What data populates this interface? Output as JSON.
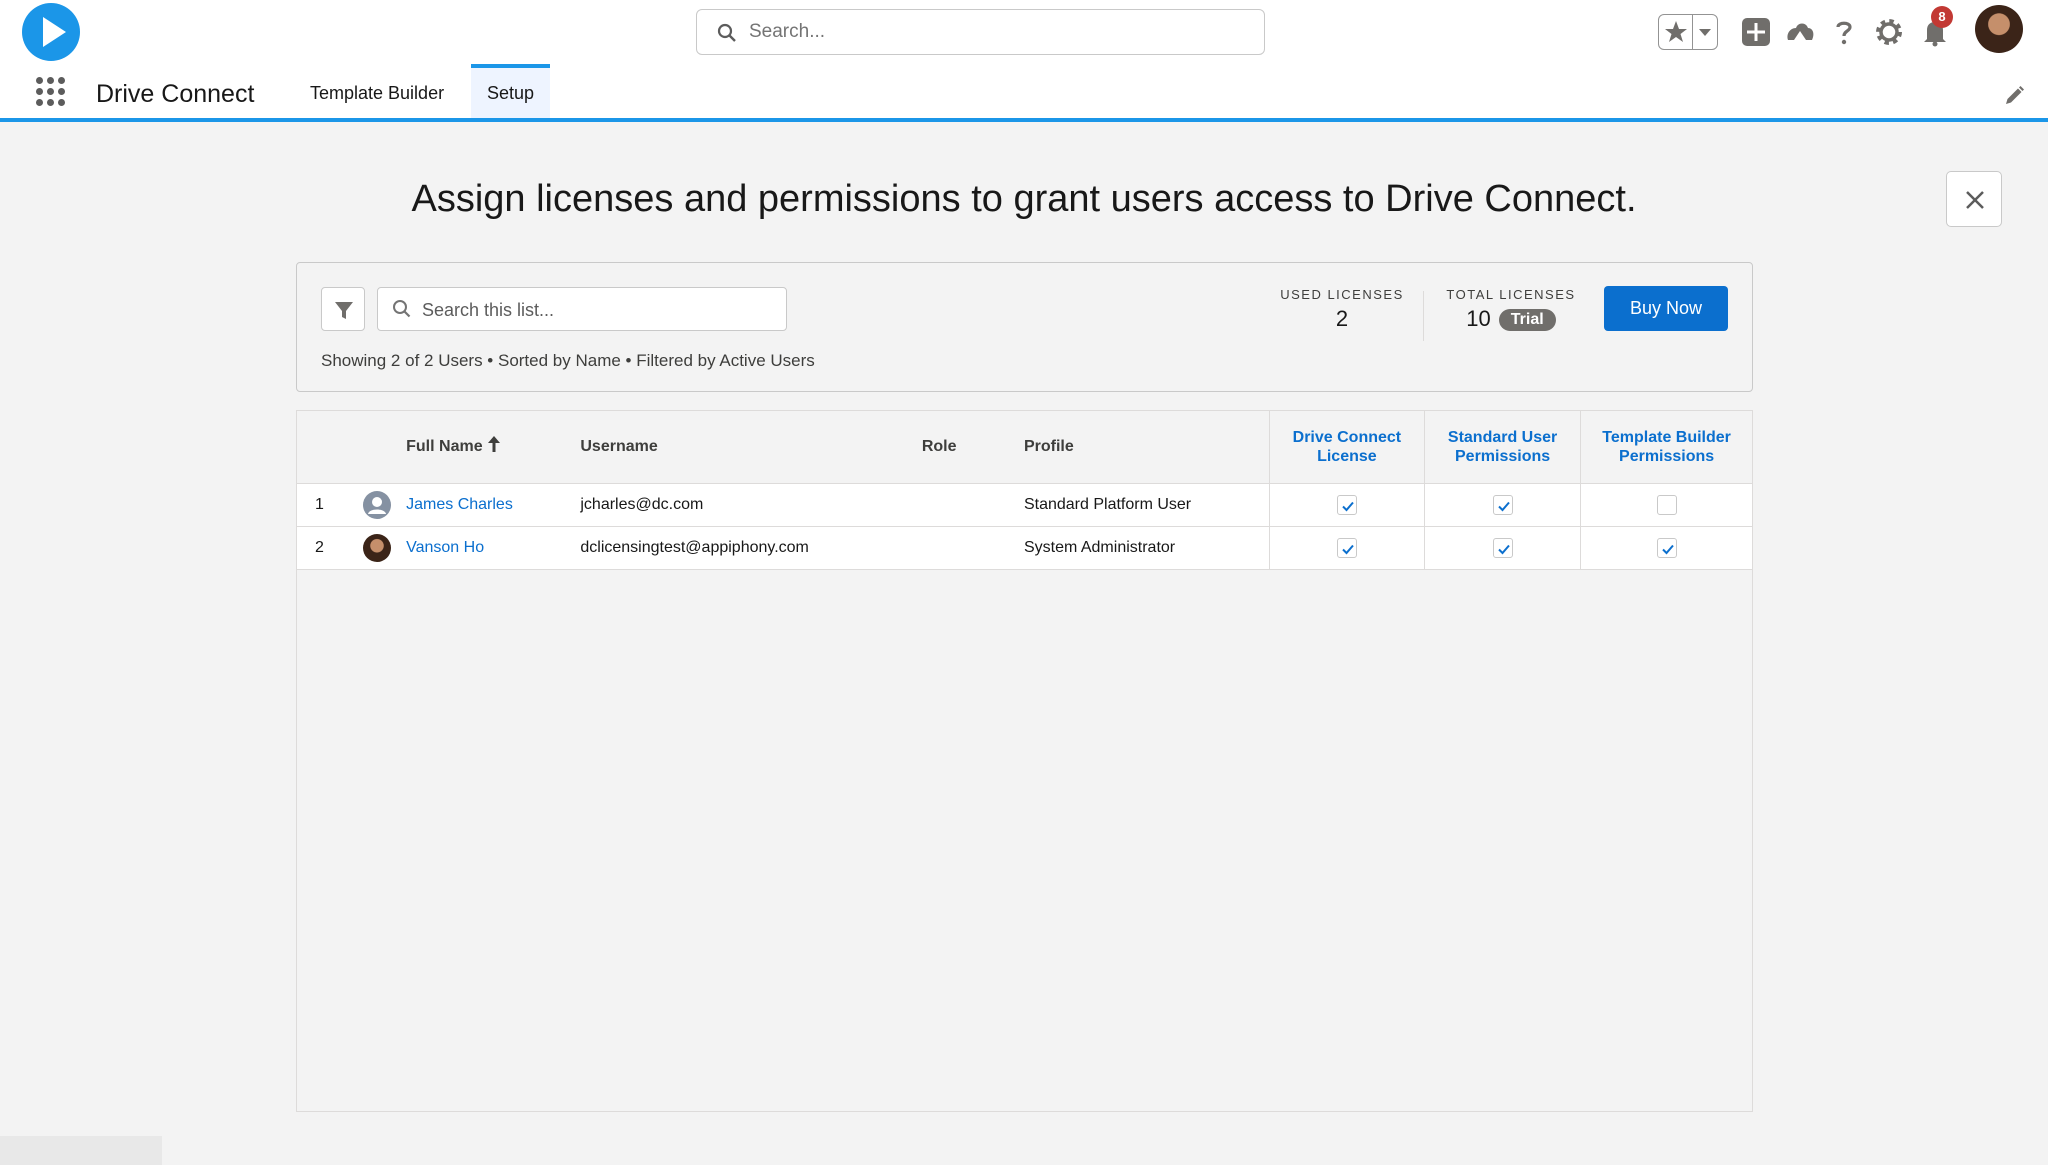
{
  "header": {
    "search_placeholder": "Search...",
    "notification_count": "8",
    "icons": [
      "play-logo-icon",
      "search-icon",
      "star-icon",
      "chevron-down-icon",
      "add-icon",
      "trailhead-icon",
      "help-icon",
      "gear-icon",
      "bell-icon"
    ]
  },
  "nav": {
    "app_name": "Drive Connect",
    "tabs": [
      {
        "label": "Template Builder",
        "active": false
      },
      {
        "label": "Setup",
        "active": true
      }
    ]
  },
  "main": {
    "title": "Assign licenses and permissions to grant users access to Drive Connect."
  },
  "toolbar": {
    "search_placeholder": "Search this list...",
    "summary": "Showing 2 of 2 Users • Sorted by Name • Filtered by Active Users",
    "used_licenses_label": "USED LICENSES",
    "used_licenses_value": "2",
    "total_licenses_label": "TOTAL LICENSES",
    "total_licenses_value": "10",
    "trial_label": "Trial",
    "buy_label": "Buy Now"
  },
  "table": {
    "headers": {
      "full_name": "Full Name",
      "username": "Username",
      "role": "Role",
      "profile": "Profile",
      "drive_connect_license": "Drive Connect License",
      "standard_user_permissions": "Standard User Permissions",
      "template_builder_permissions": "Template Builder Permissions"
    },
    "rows": [
      {
        "num": "1",
        "name": "James Charles",
        "username": "jcharles@dc.com",
        "role": "",
        "profile": "Standard Platform User",
        "license": true,
        "standard": true,
        "template": false
      },
      {
        "num": "2",
        "name": "Vanson Ho",
        "username": "dclicensingtest@appiphony.com",
        "role": "",
        "profile": "System Administrator",
        "license": true,
        "standard": true,
        "template": true
      }
    ]
  },
  "colors": {
    "brand_blue": "#1b96e8",
    "link_blue": "#0b6fce",
    "badge_red": "#c23934"
  }
}
